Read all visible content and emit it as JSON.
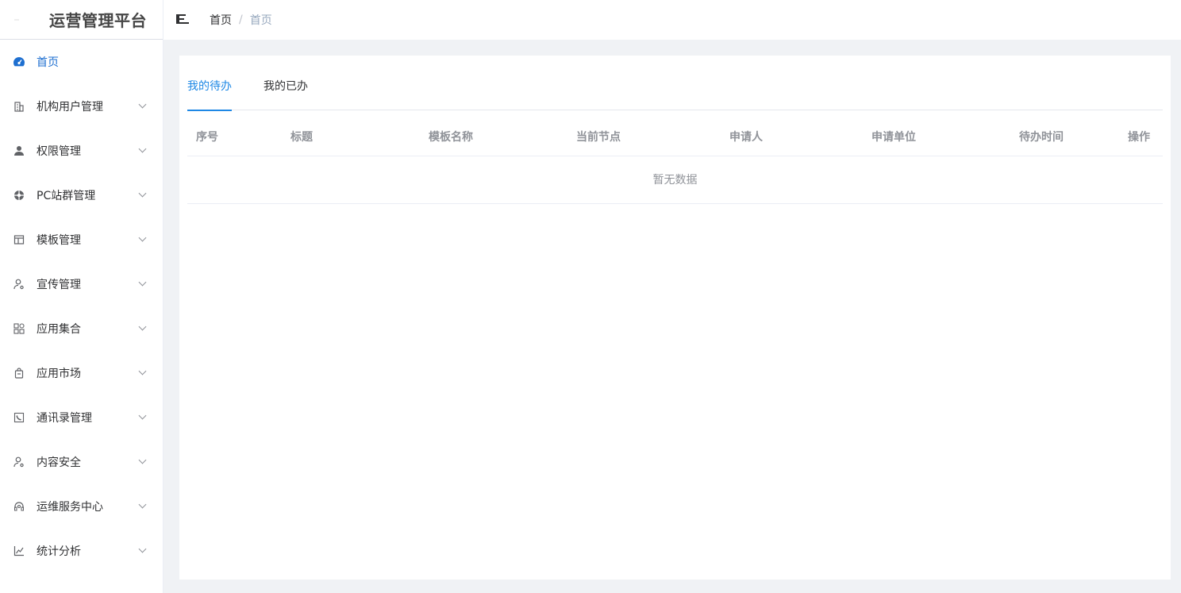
{
  "app": {
    "title": "运营管理平台"
  },
  "sidebar": {
    "items": [
      {
        "label": "首页",
        "icon": "dashboard-icon",
        "active": true,
        "expandable": false
      },
      {
        "label": "机构用户管理",
        "icon": "building-icon",
        "expandable": true
      },
      {
        "label": "权限管理",
        "icon": "user-icon",
        "expandable": true
      },
      {
        "label": "PC站群管理",
        "icon": "aperture-icon",
        "expandable": true
      },
      {
        "label": "模板管理",
        "icon": "template-icon",
        "expandable": true
      },
      {
        "label": "宣传管理",
        "icon": "person-key-icon",
        "expandable": true
      },
      {
        "label": "应用集合",
        "icon": "apps-grid-icon",
        "expandable": true
      },
      {
        "label": "应用市场",
        "icon": "shopping-bag-icon",
        "expandable": true
      },
      {
        "label": "通讯录管理",
        "icon": "phone-book-icon",
        "expandable": true
      },
      {
        "label": "内容安全",
        "icon": "person-key-icon",
        "expandable": true
      },
      {
        "label": "运维服务中心",
        "icon": "headset-icon",
        "expandable": true
      },
      {
        "label": "统计分析",
        "icon": "line-chart-icon",
        "expandable": true
      }
    ]
  },
  "header": {
    "breadcrumb": {
      "home": "首页",
      "separator": "/",
      "current": "首页"
    }
  },
  "main": {
    "tabs": [
      {
        "label": "我的待办",
        "active": true
      },
      {
        "label": "我的已办",
        "active": false
      }
    ],
    "table": {
      "columns": [
        "序号",
        "标题",
        "模板名称",
        "当前节点",
        "申请人",
        "申请单位",
        "待办时间",
        "操作"
      ],
      "rows": [],
      "empty_text": "暂无数据"
    }
  },
  "colors": {
    "accent": "#1e88e5",
    "active_menu": "#1e6fd0",
    "background": "#f0f2f5"
  }
}
